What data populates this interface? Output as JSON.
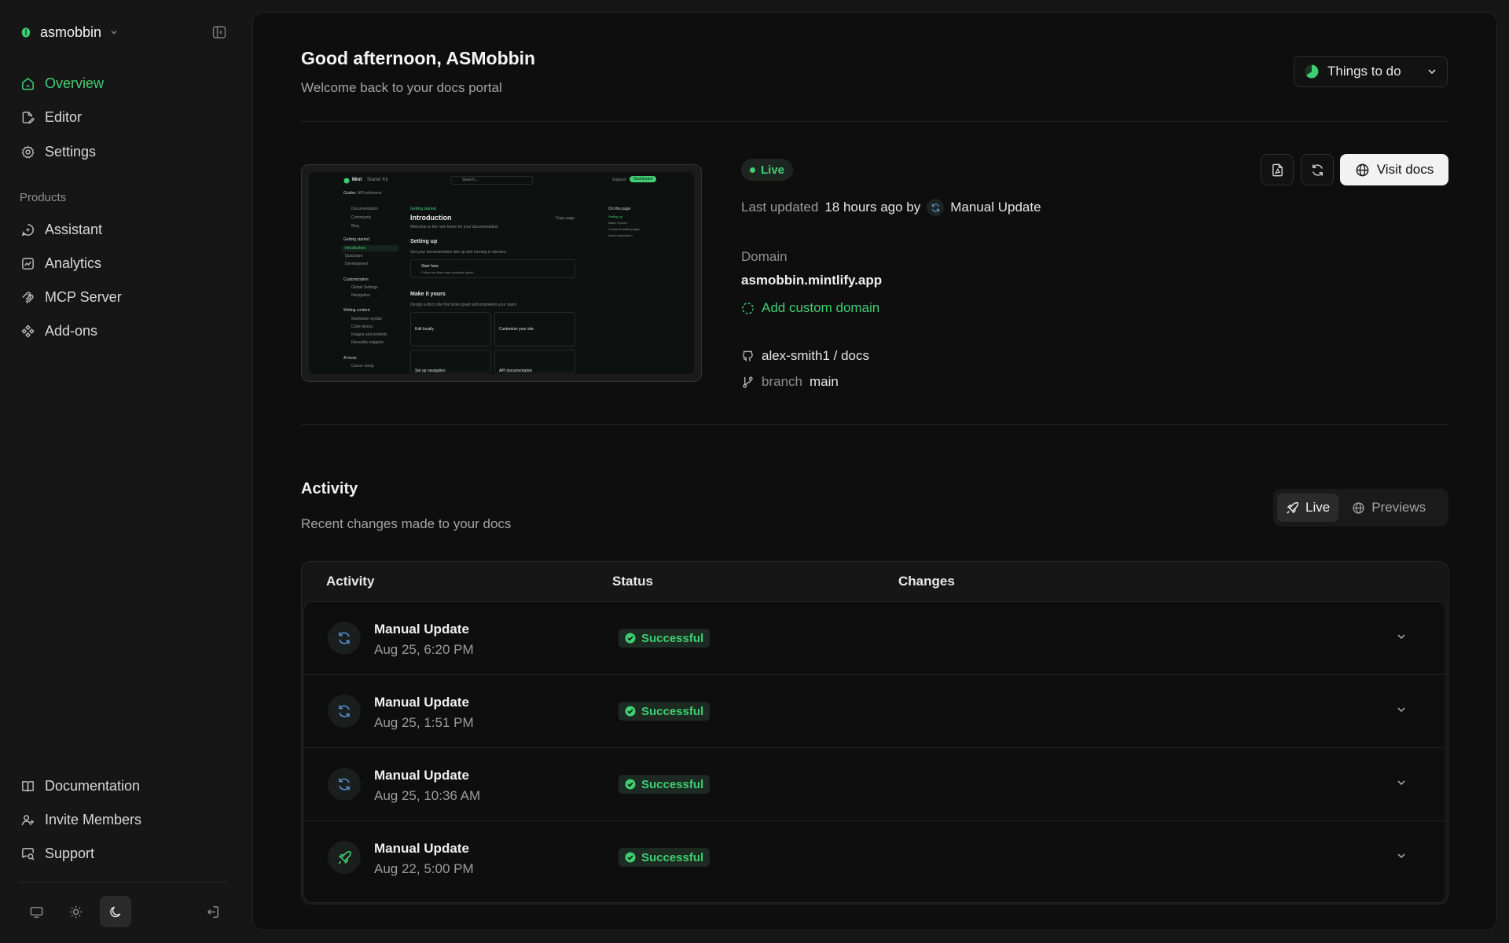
{
  "workspace": {
    "name": "asmobbin"
  },
  "sidebar": {
    "nav": [
      {
        "label": "Overview",
        "icon": "home-icon"
      },
      {
        "label": "Editor",
        "icon": "edit-file-icon"
      },
      {
        "label": "Settings",
        "icon": "gear-icon"
      }
    ],
    "products_label": "Products",
    "products": [
      {
        "label": "Assistant",
        "icon": "assistant-icon"
      },
      {
        "label": "Analytics",
        "icon": "analytics-icon"
      },
      {
        "label": "MCP Server",
        "icon": "mcp-icon"
      },
      {
        "label": "Add-ons",
        "icon": "addons-icon"
      }
    ],
    "footer": [
      {
        "label": "Documentation",
        "icon": "book-icon"
      },
      {
        "label": "Invite Members",
        "icon": "users-icon"
      },
      {
        "label": "Support",
        "icon": "support-icon"
      }
    ]
  },
  "header": {
    "greeting": "Good afternoon, ASMobbin",
    "subtitle": "Welcome back to your docs portal",
    "todo_label": "Things to do"
  },
  "preview": {
    "brand": "Mint",
    "brand_sub": "Starter Kit",
    "search": "Search...",
    "tabs": [
      "Guides",
      "API reference"
    ],
    "support": "Support",
    "dashboard": "Dashboard",
    "nav_items": [
      "Documentation",
      "Community",
      "Blog"
    ],
    "section1": "Getting started",
    "section1_items": [
      "Introduction",
      "Quickstart",
      "Development"
    ],
    "section2": "Customization",
    "section2_items": [
      "Global Settings",
      "Navigation"
    ],
    "section3": "Writing content",
    "section3_items": [
      "Markdown syntax",
      "Code blocks",
      "Images and embeds",
      "Reusable snippets"
    ],
    "section4": "AI tools",
    "section4_items": [
      "Cursor setup"
    ],
    "crumb": "Getting started",
    "page_title": "Introduction",
    "page_sub": "Welcome to the new home for your documentation",
    "copy_page": "Copy page",
    "setting_up": "Setting up",
    "setting_up_sub": "Get your documentation site up and running in minutes.",
    "start_here": "Start here",
    "start_here_sub": "Follow our three step quickstart guide.",
    "make_it_yours": "Make it yours",
    "make_it_yours_sub": "Design a docs site that looks great and empowers your users.",
    "card1": "Edit locally",
    "card2": "Customize your site",
    "card3": "Set up navigation",
    "card4": "API documentation",
    "toc_title": "On this page",
    "toc": [
      "Setting up",
      "Make it yours",
      "Create beautiful pages",
      "Need inspiration?"
    ]
  },
  "deployment": {
    "status": "Live",
    "last_updated_label": "Last updated",
    "last_updated_value": "18 hours ago by",
    "updated_by": "Manual Update",
    "visit_label": "Visit docs",
    "domain_label": "Domain",
    "domain_value": "asmobbin.mintlify.app",
    "add_domain": "Add custom domain",
    "repo": "alex-smith1 / docs",
    "branch_label": "branch",
    "branch_value": "main"
  },
  "activity": {
    "title": "Activity",
    "subtitle": "Recent changes made to your docs",
    "toggle": [
      "Live",
      "Previews"
    ],
    "columns": [
      "Activity",
      "Status",
      "Changes"
    ],
    "rows": [
      {
        "title": "Manual Update",
        "date": "Aug 25, 6:20 PM",
        "status": "Successful",
        "icon": "refresh-icon"
      },
      {
        "title": "Manual Update",
        "date": "Aug 25, 1:51 PM",
        "status": "Successful",
        "icon": "refresh-icon"
      },
      {
        "title": "Manual Update",
        "date": "Aug 25, 10:36 AM",
        "status": "Successful",
        "icon": "refresh-icon"
      },
      {
        "title": "Manual Update",
        "date": "Aug 22, 5:00 PM",
        "status": "Successful",
        "icon": "rocket-icon"
      }
    ]
  },
  "colors": {
    "accent": "#3fcf73",
    "background": "#0e0e0e",
    "sidebar": "#161616"
  }
}
